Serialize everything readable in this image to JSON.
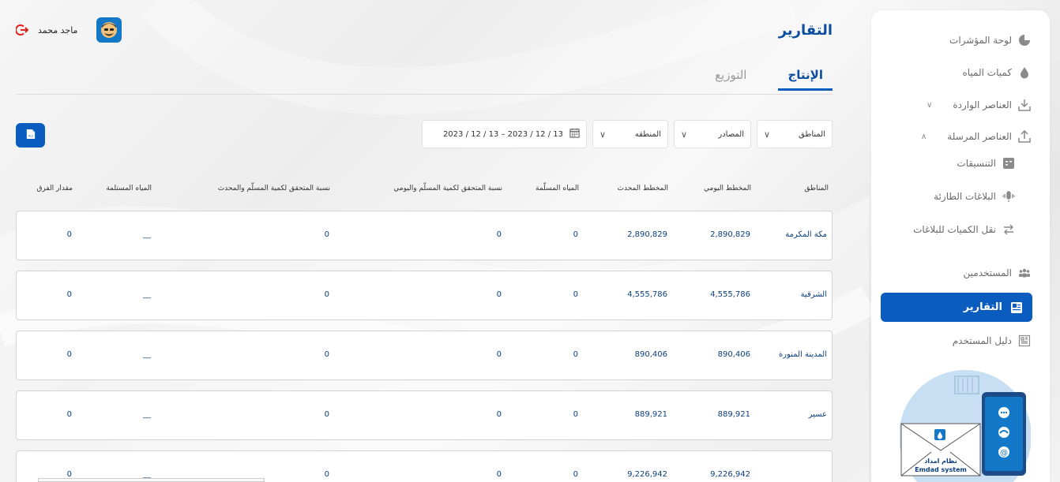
{
  "header": {
    "title": "التقارير",
    "user_name": "ماجد محمد"
  },
  "tabs": [
    {
      "label": "الإنتاج",
      "active": true
    },
    {
      "label": "التوزيع",
      "active": false
    }
  ],
  "filters": {
    "regions": "المناطق",
    "sources": "المصادر",
    "area": "المنطقه",
    "date_range": "2023 / 12 / 13 – 2023 / 12 / 13"
  },
  "sidebar": {
    "items": [
      {
        "label": "لوحة المؤشرات",
        "icon": "pie-chart-icon"
      },
      {
        "label": "كميات المياه",
        "icon": "water-drop-icon"
      },
      {
        "label": "العناصر الواردة",
        "icon": "download-icon"
      },
      {
        "label": "العناصر المرسلة",
        "icon": "upload-icon"
      },
      {
        "label": "التنسيقات",
        "icon": "format-icon"
      },
      {
        "label": "البلاغات الطارئة",
        "icon": "alert-sound-icon"
      },
      {
        "label": "نقل الكميات للبلاغات",
        "icon": "transfer-icon"
      },
      {
        "label": "المستخدمين",
        "icon": "users-icon"
      },
      {
        "label": "التقارير",
        "icon": "reports-icon"
      },
      {
        "label": "دليل المستخدم",
        "icon": "guide-icon"
      }
    ],
    "illustration_caption_ar": "نظام امداد",
    "illustration_caption_en": "Emdad system"
  },
  "table": {
    "headers": [
      "المناطق",
      "المخطط اليومي",
      "المخطط المحدث",
      "المياه المسلّمة",
      "نسبة المتحقق لكمية المسلّم واليومي",
      "نسبة المتحقق لكمية المسلّم والمحدث",
      "المياه المستلمة",
      "مقدار الفرق"
    ],
    "rows": [
      [
        "مكة المكرمة",
        "2,890,829",
        "2,890,829",
        "0",
        "0",
        "0",
        "__",
        "0"
      ],
      [
        "الشرقية",
        "4,555,786",
        "4,555,786",
        "0",
        "0",
        "0",
        "__",
        "0"
      ],
      [
        "المدينة المنورة",
        "890,406",
        "890,406",
        "0",
        "0",
        "0",
        "__",
        "0"
      ],
      [
        "عسير",
        "889,921",
        "889,921",
        "0",
        "0",
        "0",
        "__",
        "0"
      ],
      [
        "",
        "9,226,942",
        "9,226,942",
        "0",
        "0",
        "0",
        "__",
        "0"
      ]
    ]
  },
  "colors": {
    "primary": "#0b5cbf",
    "title": "#0b4e9f",
    "logout": "#dd2222"
  }
}
